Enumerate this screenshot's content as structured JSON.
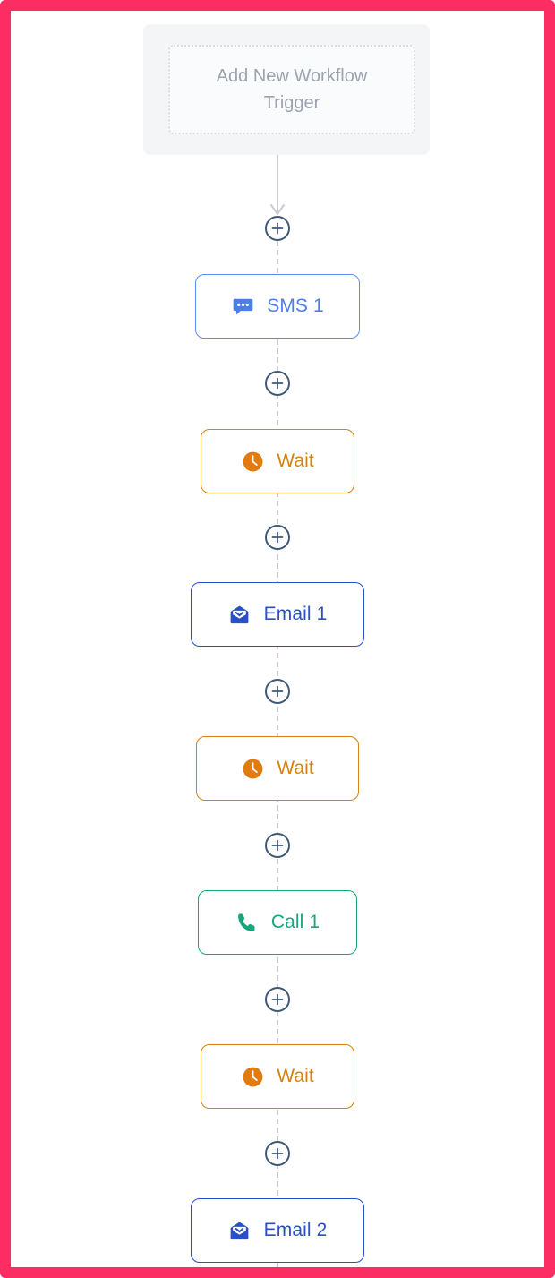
{
  "frame": {
    "accent_color": "#fb2d63",
    "canvas_background": "#ffffff"
  },
  "trigger": {
    "label": "Add New Workflow Trigger",
    "container_color": "#f4f5f7",
    "text_color": "#9ba3ae"
  },
  "connector": {
    "add_symbol": "+",
    "ring_color": "#3f5875",
    "line_color": "#c9ccd1"
  },
  "workflow": {
    "steps": [
      {
        "id": "sms-1",
        "label": "SMS 1",
        "type": "sms",
        "icon": "chat-bubble-icon",
        "color": "#4a7fe8",
        "border_color": "#5b8def"
      },
      {
        "id": "wait-1",
        "label": "Wait",
        "type": "wait",
        "icon": "clock-icon",
        "color": "#d6830f",
        "border_color": "#d6830f"
      },
      {
        "id": "email-1",
        "label": "Email 1",
        "type": "email",
        "icon": "envelope-icon",
        "color": "#2851c9",
        "border_color": "#2851c9"
      },
      {
        "id": "wait-2",
        "label": "Wait",
        "type": "wait",
        "icon": "clock-icon",
        "color": "#d6830f",
        "border_color": "#d6830f"
      },
      {
        "id": "call-1",
        "label": "Call 1",
        "type": "call",
        "icon": "phone-icon",
        "color": "#17a67c",
        "border_color": "#17a67c"
      },
      {
        "id": "wait-3",
        "label": "Wait",
        "type": "wait",
        "icon": "clock-icon",
        "color": "#d6830f",
        "border_color": "#d6830f"
      },
      {
        "id": "email-2",
        "label": "Email 2",
        "type": "email",
        "icon": "envelope-icon",
        "color": "#2851c9",
        "border_color": "#2851c9"
      }
    ]
  }
}
